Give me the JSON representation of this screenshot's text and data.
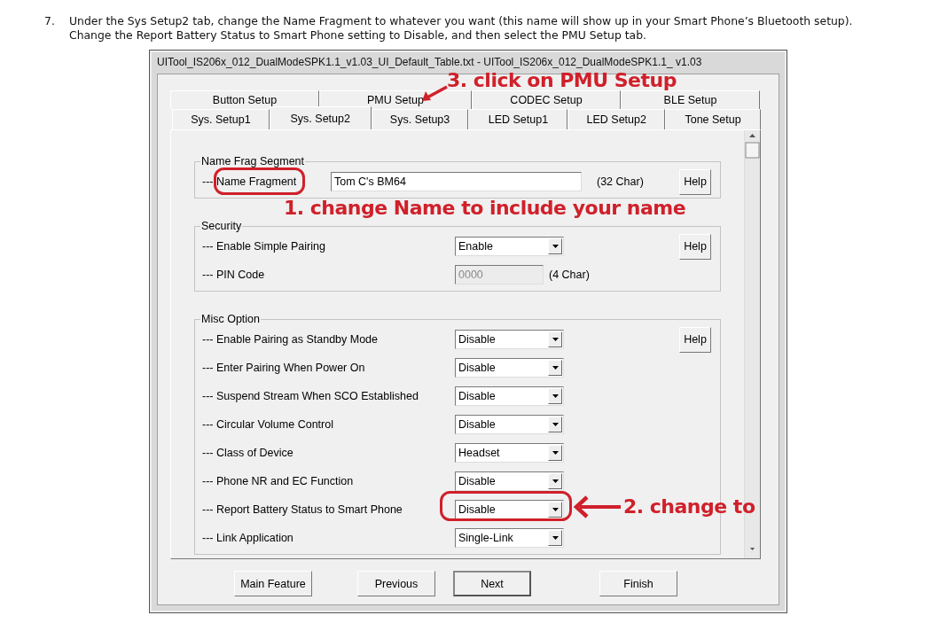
{
  "instruction": {
    "number": "7.",
    "lines": [
      "Under the Sys Setup2 tab, change the Name Fragment to whatever you want (this name will show up in your Smart Phone’s Bluetooth setup).",
      "Change the Report Battery Status to Smart Phone setting to Disable, and then select the PMU Setup tab."
    ]
  },
  "window": {
    "title": "UITool_IS206x_012_DualModeSPK1.1_v1.03_UI_Default_Table.txt - UITool_IS206x_012_DualModeSPK1.1_ v1.03"
  },
  "tabs": [
    [
      {
        "label": "Button Setup",
        "selected": false
      },
      {
        "label": "PMU Setup",
        "selected": false
      },
      {
        "label": "CODEC Setup",
        "selected": false
      },
      {
        "label": "BLE Setup",
        "selected": false
      }
    ],
    [
      {
        "label": "Sys. Setup1",
        "selected": false
      },
      {
        "label": "Sys. Setup2",
        "selected": true
      },
      {
        "label": "Sys. Setup3",
        "selected": false
      },
      {
        "label": "LED Setup1",
        "selected": false
      },
      {
        "label": "LED Setup2",
        "selected": false
      },
      {
        "label": "Tone Setup",
        "selected": false
      }
    ]
  ],
  "groups": [
    {
      "title": "Name Frag Segment",
      "help": "Help",
      "rows": [
        {
          "kind": "textbox",
          "label": "--- Name Fragment",
          "value": "Tom C's BM64",
          "note": "(32 Char)",
          "disabled": false
        }
      ]
    },
    {
      "title": "Security",
      "help": "Help",
      "rows": [
        {
          "kind": "dropdown",
          "label": "--- Enable Simple Pairing",
          "value": "Enable"
        },
        {
          "kind": "pin-box",
          "label": "--- PIN Code",
          "value": "0000",
          "note": "(4 Char)",
          "disabled": true
        }
      ]
    },
    {
      "title": "Misc Option",
      "help": "Help",
      "rows": [
        {
          "kind": "dropdown",
          "label": "--- Enable Pairing as Standby Mode",
          "value": "Disable"
        },
        {
          "kind": "dropdown",
          "label": "--- Enter Pairing When Power On",
          "value": "Disable"
        },
        {
          "kind": "dropdown",
          "label": "--- Suspend Stream When SCO Established",
          "value": "Disable"
        },
        {
          "kind": "dropdown",
          "label": "--- Circular Volume Control",
          "value": "Disable"
        },
        {
          "kind": "dropdown",
          "label": "--- Class of Device",
          "value": "Headset"
        },
        {
          "kind": "dropdown",
          "label": "--- Phone NR and EC Function",
          "value": "Disable"
        },
        {
          "kind": "dropdown",
          "label": "--- Report Battery Status to Smart Phone",
          "value": "Disable"
        },
        {
          "kind": "dropdown",
          "label": "--- Link Application",
          "value": "Single-Link"
        }
      ]
    }
  ],
  "buttons": [
    {
      "label": "Main Feature",
      "default": false
    },
    {
      "label": "Previous",
      "default": false
    },
    {
      "label": "Next",
      "default": true
    },
    {
      "label": "Finish",
      "default": false
    }
  ],
  "annotations": [
    {
      "kind": "arrow-text",
      "text": "3. click on PMU Setup"
    },
    {
      "kind": "caption",
      "text": "1. change Name to include your name"
    },
    {
      "kind": "arrow-text",
      "text": "2. change to"
    }
  ]
}
